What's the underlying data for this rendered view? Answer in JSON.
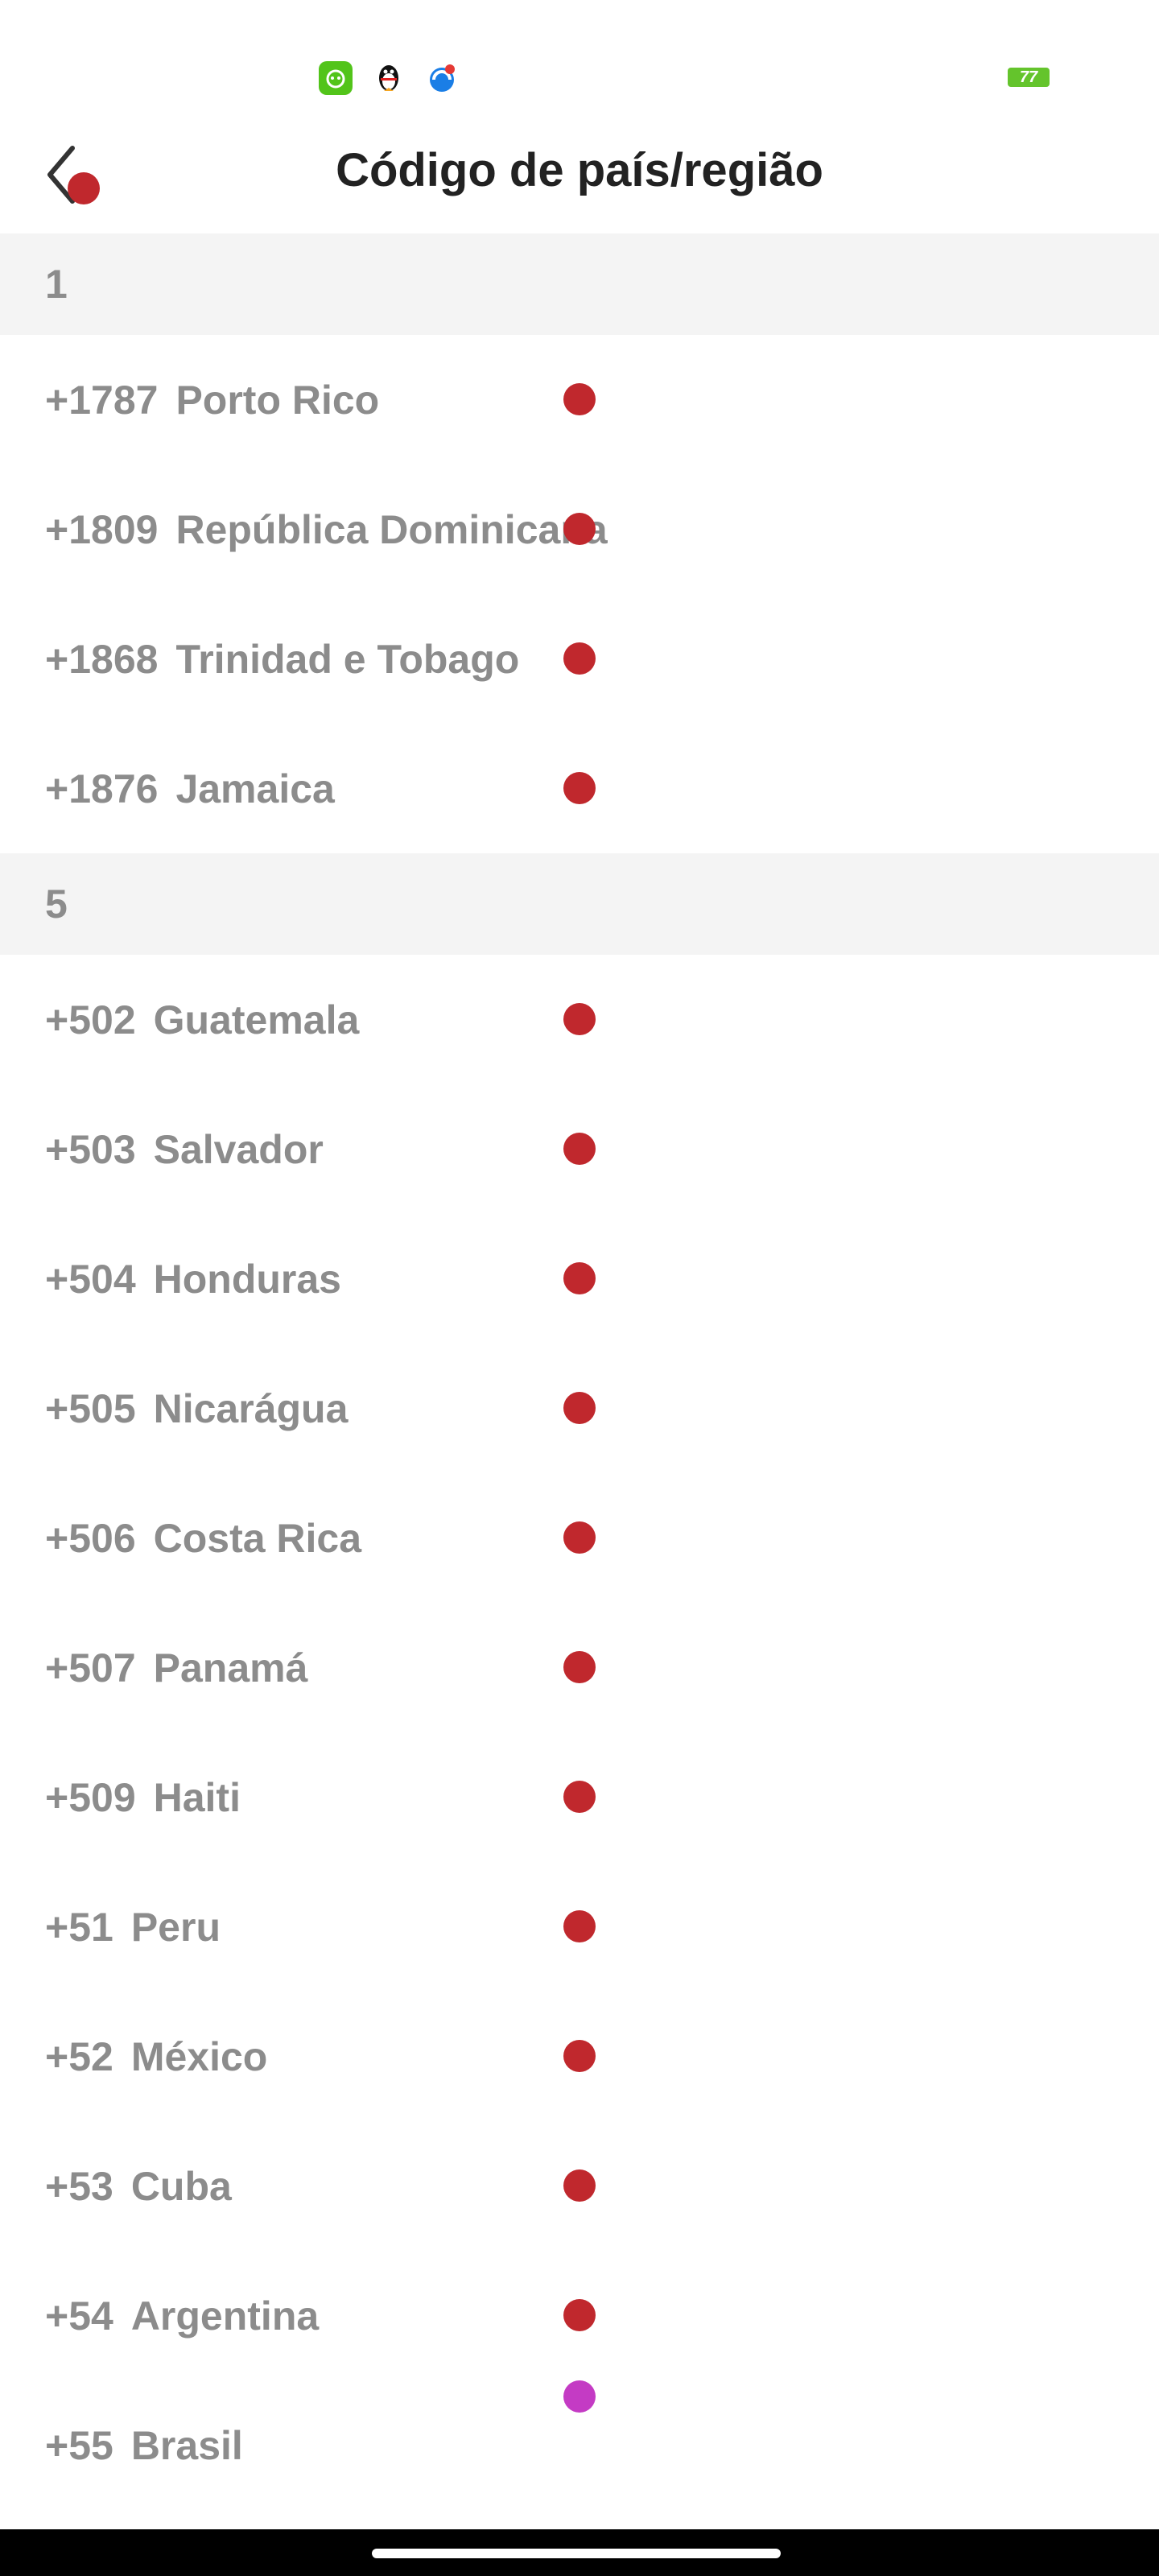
{
  "header": {
    "title": "Código de país/região"
  },
  "status": {
    "battery": "77"
  },
  "sections": [
    {
      "label": "1",
      "items": [
        {
          "code": "+1787",
          "name": "Porto Rico"
        },
        {
          "code": "+1809",
          "name": "República Dominicana"
        },
        {
          "code": "+1868",
          "name": "Trinidad e Tobago"
        },
        {
          "code": "+1876",
          "name": "Jamaica"
        }
      ]
    },
    {
      "label": "5",
      "items": [
        {
          "code": "+502",
          "name": "Guatemala"
        },
        {
          "code": "+503",
          "name": "Salvador"
        },
        {
          "code": "+504",
          "name": "Honduras"
        },
        {
          "code": "+505",
          "name": "Nicarágua"
        },
        {
          "code": "+506",
          "name": "Costa Rica"
        },
        {
          "code": "+507",
          "name": "Panamá"
        },
        {
          "code": "+509",
          "name": "Haiti"
        },
        {
          "code": "+51",
          "name": "Peru"
        },
        {
          "code": "+52",
          "name": "México"
        },
        {
          "code": "+53",
          "name": "Cuba"
        },
        {
          "code": "+54",
          "name": "Argentina"
        },
        {
          "code": "+55",
          "name": "Brasil"
        }
      ]
    }
  ],
  "colors": {
    "marker": "#c0282d",
    "marker_highlight": "#c43bc4",
    "muted_text": "#8c8c8c"
  }
}
